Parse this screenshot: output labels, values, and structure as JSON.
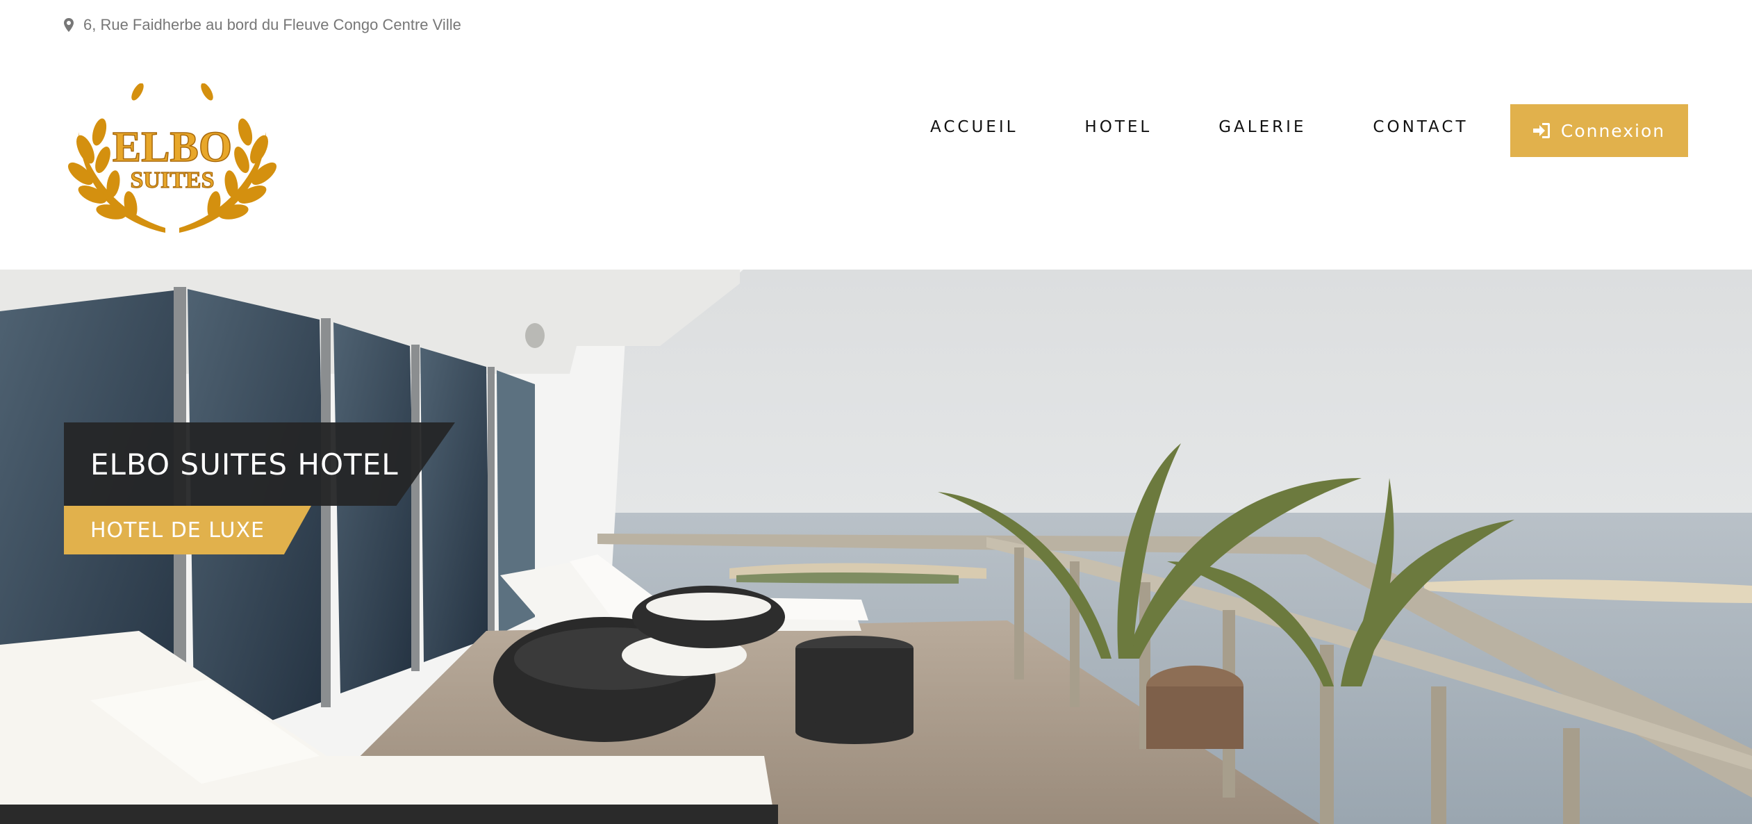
{
  "topbar": {
    "address": "6, Rue Faidherbe au bord du Fleuve Congo Centre Ville",
    "icon": "map-marker-icon"
  },
  "logo": {
    "line1": "ELBO",
    "line2": "SUITES",
    "color": "#d4900f"
  },
  "nav": {
    "items": [
      {
        "label": "ACCUEIL"
      },
      {
        "label": "HOTEL"
      },
      {
        "label": "GALERIE"
      },
      {
        "label": "CONTACT"
      }
    ],
    "login_label": "Connexion",
    "login_icon": "sign-in-icon",
    "accent": "#e1b14c"
  },
  "hero": {
    "title": "ELBO SUITES HOTEL",
    "subtitle": "HOTEL DE LUXE",
    "title_bg": "#252627",
    "subtitle_bg": "#e1b14c"
  }
}
